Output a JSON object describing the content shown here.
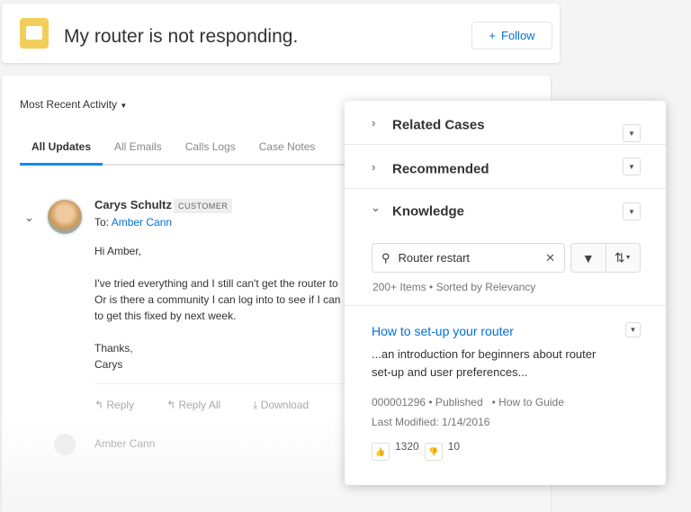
{
  "header": {
    "title": "My router is not responding.",
    "follow_label": "Follow",
    "follow_icon": "plus-icon",
    "case_icon_color": "#f2cf5b"
  },
  "feed": {
    "sort_label": "Most Recent Activity",
    "tabs": [
      {
        "label": "All Updates",
        "active": true
      },
      {
        "label": "All Emails"
      },
      {
        "label": "Calls Logs"
      },
      {
        "label": "Case Notes"
      }
    ],
    "post": {
      "sender": "Carys Schultz",
      "badge": "CUSTOMER",
      "to_label": "To:",
      "to_name": "Amber Cann",
      "body": "Hi Amber,\n\nI've tried everything and I still can't get the router to\nOr is there a community I can log into to see if I can\nto get this fixed by next week.\n\nThanks,\nCarys",
      "actions": [
        "Reply",
        "Reply All",
        "Download"
      ]
    },
    "next_sender": "Amber Cann"
  },
  "panel": {
    "sections": [
      {
        "label": "Related Cases",
        "expanded": false
      },
      {
        "label": "Recommended",
        "expanded": false
      },
      {
        "label": "Knowledge",
        "expanded": true
      }
    ],
    "search": {
      "value": "Router restart"
    },
    "count": "200+ Items • Sorted by Relevancy",
    "article": {
      "title": "How to set-up your router",
      "desc": "...an introduction for beginners about router set-up and user preferences...",
      "meta1": "000001296 • Published   • How to Guide",
      "meta2": "Last Modified: 1/14/2016",
      "upvotes": "1320",
      "downvotes": "10"
    }
  }
}
